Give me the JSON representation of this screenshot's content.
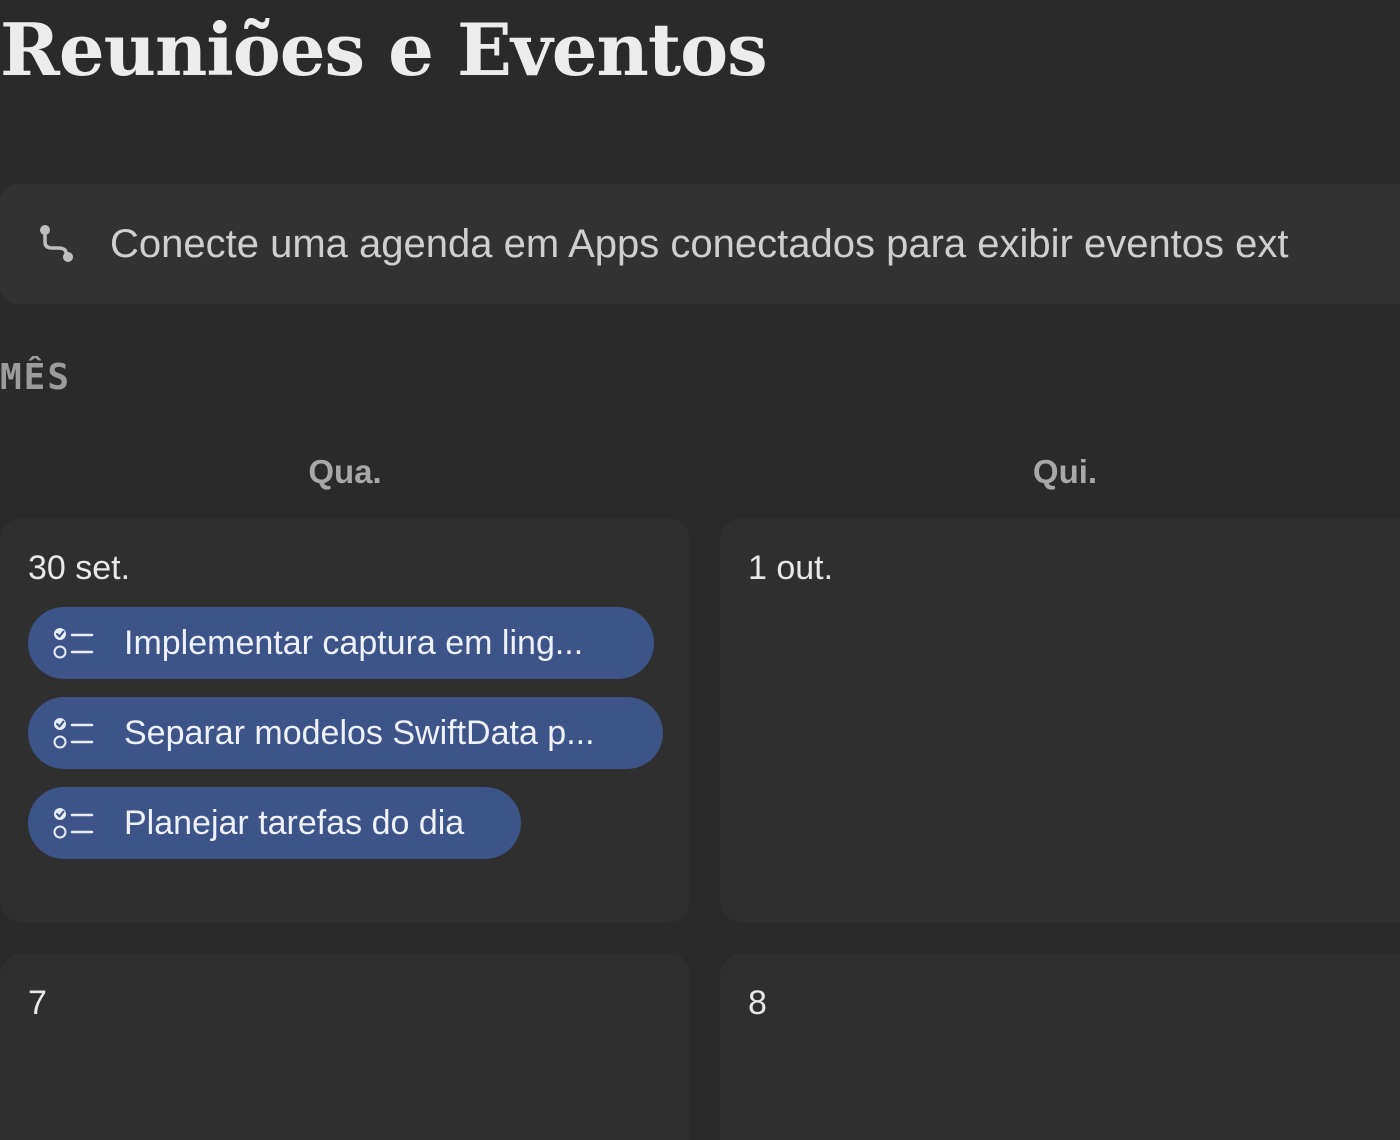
{
  "header": {
    "title": "Reuniões e Eventos"
  },
  "banner": {
    "icon": "branch-icon",
    "text": "Conecte uma agenda em Apps conectados para exibir eventos ext"
  },
  "calendar": {
    "section_label": "MÊS",
    "weekdays": [
      "Qua.",
      "Qui."
    ],
    "days": [
      {
        "label": "30 set.",
        "events": [
          {
            "title": "Implementar captura em ling...",
            "icon": "task-list-icon"
          },
          {
            "title": "Separar modelos SwiftData p...",
            "icon": "task-list-icon"
          },
          {
            "title": "Planejar tarefas do dia",
            "icon": "task-list-icon"
          }
        ]
      },
      {
        "label": "1 out.",
        "events": []
      },
      {
        "label": "7",
        "events": []
      },
      {
        "label": "8",
        "events": []
      }
    ]
  },
  "colors": {
    "background": "#2a2a2a",
    "cell": "#2f2f2f",
    "banner": "#323232",
    "event_pill": "#3d5489"
  }
}
